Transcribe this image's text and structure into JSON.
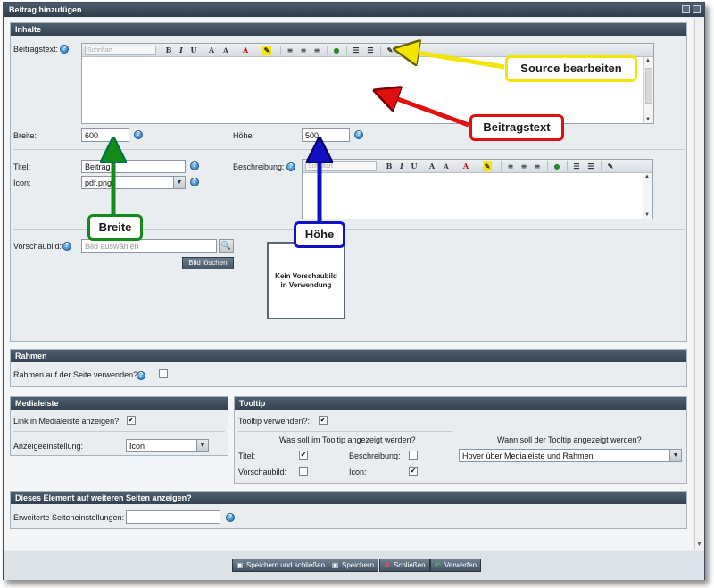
{
  "window": {
    "title": "Beitrag hinzufügen"
  },
  "inhalt": {
    "heading": "Inhalte",
    "beitragstext_label": "Beitragstext:",
    "font_placeholder": "Schriftart",
    "breite_label": "Breite:",
    "breite_value": "600",
    "hoehe_label": "Höhe:",
    "hoehe_value": "500",
    "titel_label": "Titel:",
    "titel_value": "Beitrag",
    "icon_label": "Icon:",
    "icon_value": "pdf.png",
    "beschreibung_label": "Beschreibung:",
    "vorschaubild_label": "Vorschaubild:",
    "vorschaubild_placeholder": "Bild auswählen",
    "bild_loeschen": "Bild löschen",
    "kein_vorschaubild": "Kein Vorschaubild in Verwendung"
  },
  "rahmen": {
    "heading": "Rahmen",
    "label": "Rahmen auf der Seite verwenden?:",
    "checked": false
  },
  "medialeiste": {
    "heading": "Medialeiste",
    "link_label": "Link in Medialeiste anzeigen?:",
    "link_checked": true,
    "anzeige_label": "Anzeigeeinstellung:",
    "anzeige_value": "Icon"
  },
  "tooltip": {
    "heading": "Tooltip",
    "verwenden_label": "Tooltip verwenden?:",
    "verwenden_checked": true,
    "was_heading": "Was soll im Tooltip angezeigt werden?",
    "wann_heading": "Wann soll der Tooltip angezeigt werden?",
    "titel_label": "Titel:",
    "titel_checked": true,
    "beschreibung_label": "Beschreibung:",
    "beschreibung_checked": false,
    "vorschaubild_label": "Vorschaubild:",
    "vorschaubild_checked": false,
    "icon_label": "Icon:",
    "icon_checked": true,
    "wann_value": "Hover über Medialeiste und Rahmen"
  },
  "weitere": {
    "heading": "Dieses Element auf weiteren Seiten anzeigen?",
    "label": "Erweiterte Seiteneinstellungen:",
    "value": ""
  },
  "footer": {
    "save_close": "Speichern und schließen",
    "save": "Speichern",
    "close": "Schließen",
    "discard": "Verwerfen"
  },
  "callouts": {
    "source": "Source bearbeiten",
    "beitragstext": "Beitragstext",
    "breite": "Breite",
    "hoehe": "Höhe"
  },
  "colors": {
    "callout_yellow": "#f2e600",
    "callout_red": "#e01010",
    "callout_green": "#138a1a",
    "callout_blue": "#1010c8"
  }
}
